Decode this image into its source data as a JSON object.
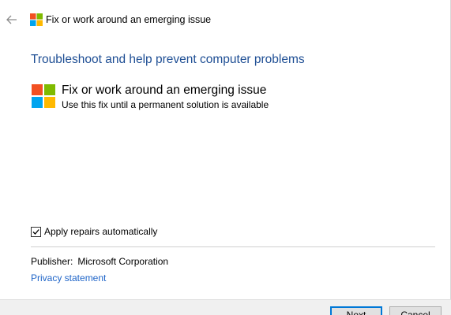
{
  "window": {
    "title": "Fix or work around an emerging issue",
    "back_icon": "back-arrow-icon",
    "logo_icon": "windows-logo-icon"
  },
  "main": {
    "heading": "Troubleshoot and help prevent computer problems",
    "fix_title": "Fix or work around an emerging issue",
    "fix_subtitle": "Use this fix until a permanent solution is available"
  },
  "options": {
    "apply_repairs_label": "Apply repairs automatically",
    "apply_repairs_checked": true
  },
  "publisher": {
    "label": "Publisher:",
    "name": "Microsoft Corporation"
  },
  "privacy_link": "Privacy statement",
  "buttons": {
    "next": "Next",
    "cancel": "Cancel"
  },
  "colors": {
    "heading_blue": "#1e4e94",
    "link_blue": "#1e64c8",
    "logo_red": "#f25022",
    "logo_green": "#7fba00",
    "logo_blue": "#00a4ef",
    "logo_yellow": "#ffb900",
    "accent_focus": "#0078d7"
  }
}
